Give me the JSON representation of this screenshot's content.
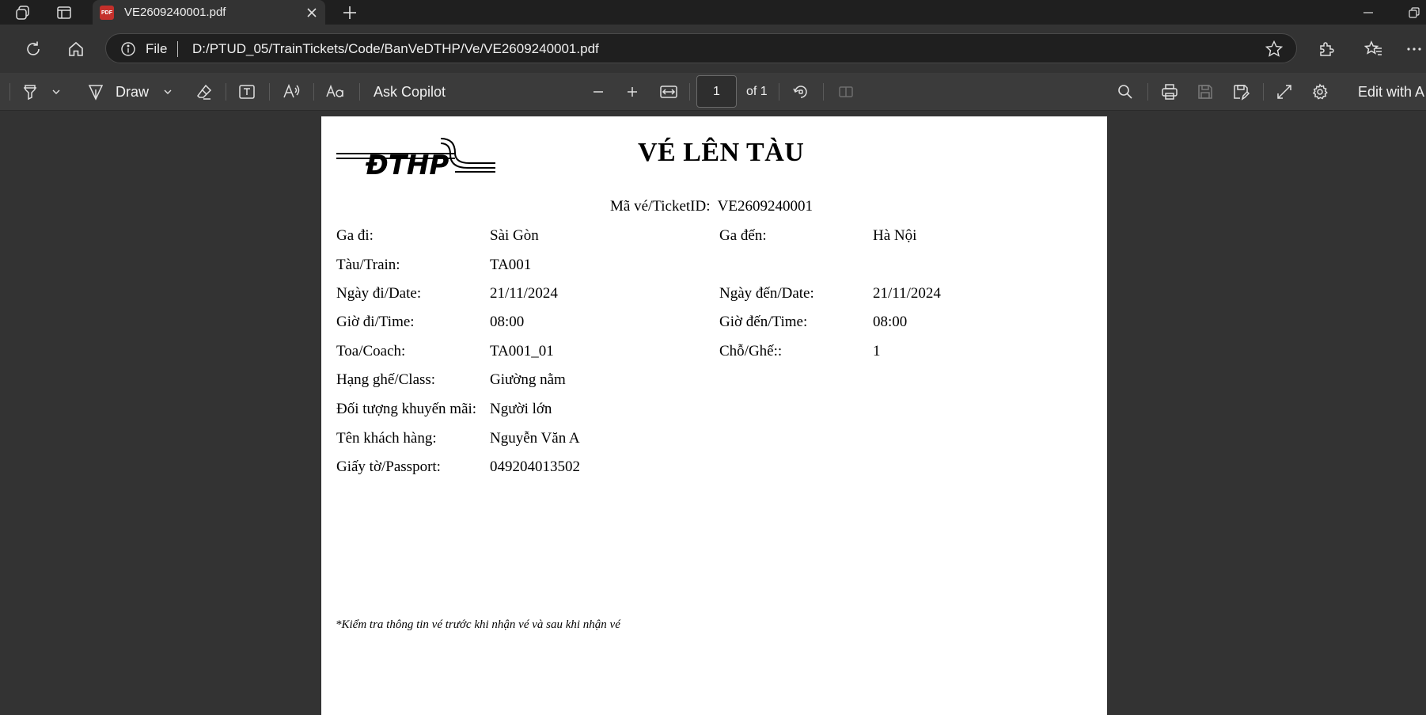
{
  "tab": {
    "title": "VE2609240001.pdf",
    "badge": "PDF"
  },
  "address": {
    "scheme_label": "File",
    "url": "D:/PTUD_05/TrainTickets/Code/BanVeDTHP/Ve/VE2609240001.pdf"
  },
  "pdf_toolbar": {
    "draw_label": "Draw",
    "ask_copilot_label": "Ask Copilot",
    "page_current": "1",
    "page_total_label": "of 1",
    "edit_label": "Edit with A"
  },
  "ticket": {
    "logo_text": "ĐTHP",
    "title": "VÉ LÊN TÀU",
    "ticket_id_label": "Mã vé/TicketID:",
    "ticket_id": "VE2609240001",
    "rows_left": [
      {
        "label": "Ga đi:",
        "value": "Sài Gòn"
      },
      {
        "label": "Tàu/Train:",
        "value": "TA001"
      },
      {
        "label": "Ngày đi/Date:",
        "value": "21/11/2024"
      },
      {
        "label": "Giờ đi/Time:",
        "value": "08:00"
      },
      {
        "label": "Toa/Coach:",
        "value": "TA001_01"
      },
      {
        "label": "Hạng ghế/Class:",
        "value": "Giường nằm"
      },
      {
        "label": "Đối tượng khuyến mãi:",
        "value": "Người lớn"
      },
      {
        "label": "Tên khách hàng:",
        "value": "Nguyễn Văn A"
      },
      {
        "label": "Giấy tờ/Passport:",
        "value": "049204013502"
      }
    ],
    "rows_right": [
      {
        "label": "Ga đến:",
        "value": "Hà Nội"
      },
      {
        "label": "Ngày đến/Date:",
        "value": "21/11/2024"
      },
      {
        "label": "Giờ đến/Time:",
        "value": "08:00"
      },
      {
        "label": "Chỗ/Ghế::",
        "value": "1"
      }
    ],
    "note": "*Kiểm tra thông tin vé trước khi nhận vé và sau khi nhận vé"
  },
  "colors": {
    "chrome_dark": "#1f1f1f",
    "chrome": "#333333",
    "toolbar": "#3b3b3b",
    "pdf_badge": "#c4302b",
    "page": "#ffffff"
  }
}
